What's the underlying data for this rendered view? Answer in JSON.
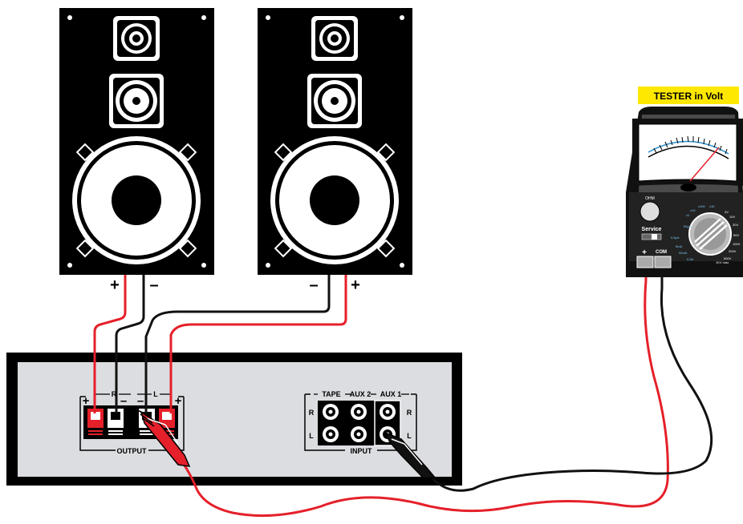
{
  "tester": {
    "title": "TESTER in Volt",
    "switch_label": "Service",
    "knob_label": "OHM",
    "terminal_plus": "+",
    "terminal_com": "COM",
    "range_labels": [
      "x1",
      "x10",
      "x100",
      "x1K",
      "2V",
      "10V",
      "20V",
      "50V",
      "100V",
      "200V",
      "500V",
      "1KV max",
      "50μA",
      "0,5μA",
      "5mA",
      "50mA",
      "0,5A"
    ]
  },
  "speakers": {
    "left": {
      "plus": "+",
      "minus": "–"
    },
    "right": {
      "minus": "–",
      "plus": "+"
    }
  },
  "amplifier": {
    "output_label": "OUTPUT",
    "output_r": "R",
    "output_l": "L",
    "output_signs": [
      "+",
      "–",
      "–",
      "+"
    ],
    "input_label": "INPUT",
    "input_groups": [
      "TAPE",
      "AUX 2",
      "AUX 1"
    ],
    "input_side_left": [
      "R",
      "L"
    ],
    "input_side_right": [
      "R",
      "L"
    ]
  },
  "colors": {
    "red_wire": "#e5202a",
    "black_wire": "#111111",
    "yellow_label": "#ffe800",
    "panel_grey": "#dcdde0",
    "scale_blue": "#2a8fd0"
  }
}
